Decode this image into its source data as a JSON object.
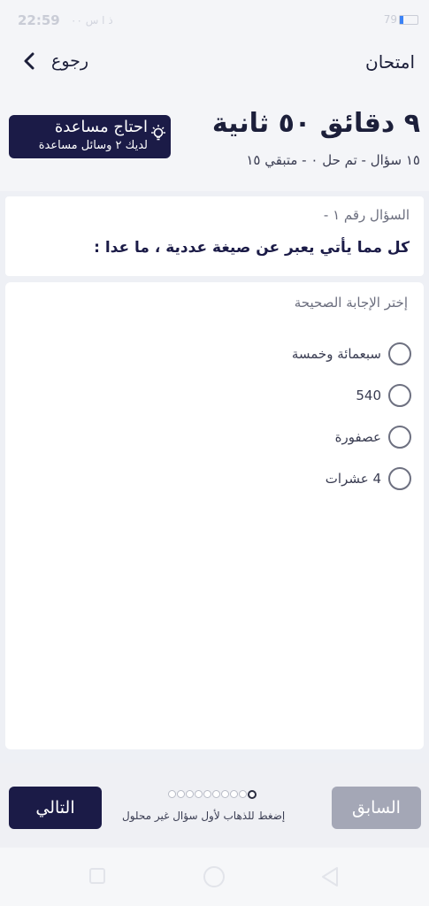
{
  "status_bar": {
    "time": "22:59",
    "extra": "ذ ا س ٠٠",
    "right_text": "79",
    "battery_level": 0.2
  },
  "header": {
    "title": "امتحان",
    "back_label": "رجوع"
  },
  "exam": {
    "timer": "٩ دقائق ٥٠ ثانية",
    "progress": "١٥ سؤال - تم حل ٠ - متبقي ١٥",
    "help_button_title": "احتاج مساعدة",
    "help_button_sub": "لديك ٢ وسائل مساعدة"
  },
  "question": {
    "number_label": "السؤال رقم ١ -",
    "text": "كل مما يأتي يعبر عن صيغة عددية ، ما عدا :"
  },
  "answers": {
    "title": "إختر الإجابة الصحيحة",
    "options": [
      "سبعمائة وخمسة",
      "540",
      "عصفورة",
      "4 عشرات"
    ]
  },
  "footer": {
    "next_label": "التالي",
    "prev_label": "السابق",
    "hint": "إضغط للذهاب لأول سؤال غير محلول",
    "total_questions": 10,
    "current_question": 1
  },
  "icons": {
    "back": "chevron-left-icon",
    "help": "lightbulb-icon",
    "radio": "radio-unchecked-icon",
    "nav_recent": "square-icon",
    "nav_home": "circle-icon",
    "nav_back": "triangle-back-icon"
  },
  "colors": {
    "primary": "#1b1b47",
    "disabled": "#a4a7b6",
    "background": "#eef0f5"
  }
}
